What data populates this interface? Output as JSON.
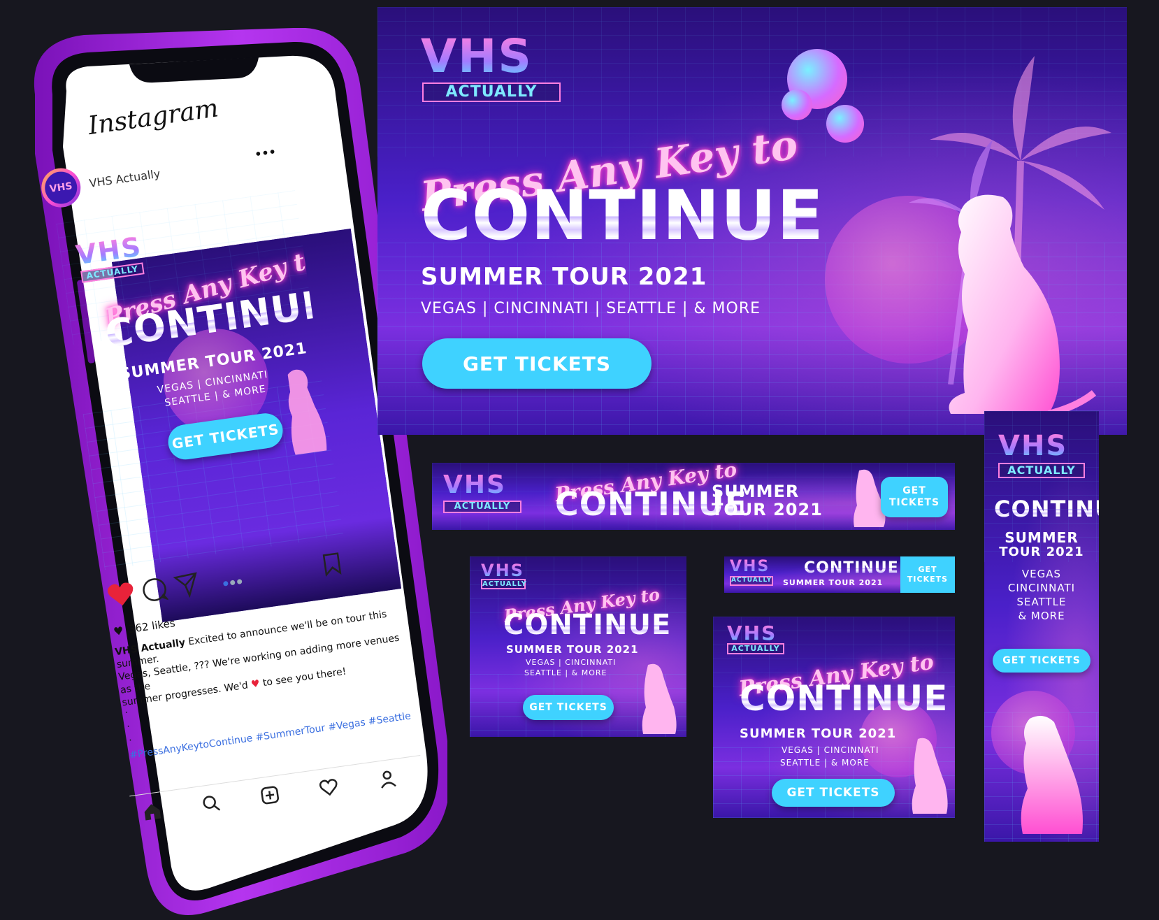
{
  "brand": {
    "logo_main": "VHS",
    "logo_sub": "ACTUALLY"
  },
  "campaign": {
    "script_line": "Press Any Key to",
    "title": "CONTINUE",
    "tour": "SUMMER TOUR 2021",
    "tour_line1": "SUMMER",
    "tour_line2": "TOUR 2021",
    "cities_inline": "VEGAS | CINCINNATI | SEATTLE | & MORE",
    "cities_line1": "VEGAS | CINCINNATI",
    "cities_line2": "SEATTLE | & MORE",
    "vertical_cities": [
      "VEGAS",
      "CINCINNATI",
      "SEATTLE",
      "& MORE"
    ],
    "cta": "GET TICKETS",
    "cta_line1": "GET",
    "cta_line2": "TICKETS"
  },
  "instagram": {
    "app_name": "Instagram",
    "account": "VHS Actually",
    "more": "•••",
    "likes": "362 likes",
    "caption_user": "VHS Actually",
    "caption_line1": "Excited to announce we'll be on tour this summer.",
    "caption_line2": "Vegas, Seattle, ??? We're working on adding more venues as the",
    "caption_line3": "summer progresses. We'd",
    "caption_line4": "to see you there!",
    "dots": ".",
    "hashtags": "#PressAnyKeytoContinue #SummerTour #Vegas #Seattle"
  },
  "colors": {
    "phone_frame": "#9b1fd6",
    "cta": "#3fd2ff",
    "accent_pink": "#ff4fd2",
    "heart": "#e8233a"
  },
  "icons": [
    "heart-icon",
    "comment-icon",
    "share-icon",
    "bookmark-icon",
    "home-icon",
    "search-icon",
    "add-icon",
    "activity-icon",
    "profile-icon"
  ]
}
